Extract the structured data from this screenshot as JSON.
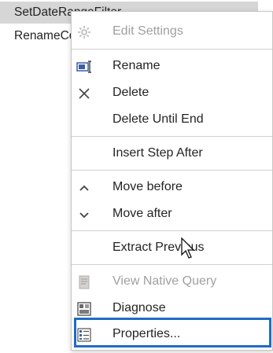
{
  "steps": {
    "selected": "SetDateRangeFilter",
    "next": "RenameColumns"
  },
  "menu": {
    "items": [
      {
        "label": "Edit Settings",
        "icon": "gear-icon",
        "disabled": true
      },
      {
        "label": "Rename",
        "icon": "rename-icon",
        "disabled": false
      },
      {
        "label": "Delete",
        "icon": "close-icon",
        "disabled": false
      },
      {
        "label": "Delete Until End",
        "icon": "",
        "disabled": false
      },
      {
        "label": "Insert Step After",
        "icon": "",
        "disabled": false
      },
      {
        "label": "Move before",
        "icon": "chevron-up-icon",
        "disabled": false
      },
      {
        "label": "Move after",
        "icon": "chevron-down-icon",
        "disabled": false
      },
      {
        "label": "Extract Previous",
        "icon": "",
        "disabled": false
      },
      {
        "label": "View Native Query",
        "icon": "document-icon",
        "disabled": true
      },
      {
        "label": "Diagnose",
        "icon": "diagnose-icon",
        "disabled": false
      },
      {
        "label": "Properties...",
        "icon": "properties-icon",
        "disabled": false
      }
    ]
  },
  "colors": {
    "highlight": "#1f6cc4",
    "selected_row": "#d6d6d6",
    "disabled_text": "#a19f9d"
  }
}
